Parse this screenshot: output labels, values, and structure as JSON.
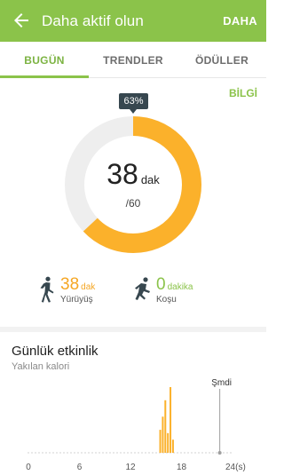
{
  "appbar": {
    "title": "Daha aktif olun",
    "more_label": "DAHA",
    "background": "#8bc34a",
    "back_icon": "arrow-left-icon"
  },
  "tabs": [
    {
      "label": "BUGÜN",
      "selected": true
    },
    {
      "label": "TRENDLER",
      "selected": false
    },
    {
      "label": "ÖDÜLLER",
      "selected": false
    }
  ],
  "info_label": "BİLGİ",
  "progress": {
    "percent_label": "63%",
    "fraction": 0.63,
    "value": "38",
    "unit": "dak",
    "goal": "/60",
    "color_done": "#fbb12b",
    "color_track": "#eeeeee"
  },
  "activities": {
    "walking": {
      "value": "38",
      "unit": "dak",
      "label": "Yürüyüş",
      "icon": "walking-person-icon",
      "color": "#f5a623"
    },
    "running": {
      "value": "0",
      "unit": "dakika",
      "label": "Koşu",
      "icon": "running-person-icon",
      "color": "#8bc34a"
    }
  },
  "daily": {
    "title": "Günlük etkinlik",
    "subtitle": "Yakılan kalori",
    "now_label": "Şmdi"
  },
  "chart_data": {
    "type": "bar",
    "x_ticks": [
      "0",
      "6",
      "12",
      "18",
      "24(s)"
    ],
    "xlim": [
      0,
      24
    ],
    "now_hour": 22.5,
    "bar_color": "#fbb12b",
    "bars": [
      {
        "x": 15.5,
        "value": 35
      },
      {
        "x": 15.8,
        "value": 55
      },
      {
        "x": 16.1,
        "value": 80
      },
      {
        "x": 16.4,
        "value": 30
      },
      {
        "x": 16.7,
        "value": 100
      },
      {
        "x": 17.0,
        "value": 20
      }
    ],
    "ymax": 100
  }
}
